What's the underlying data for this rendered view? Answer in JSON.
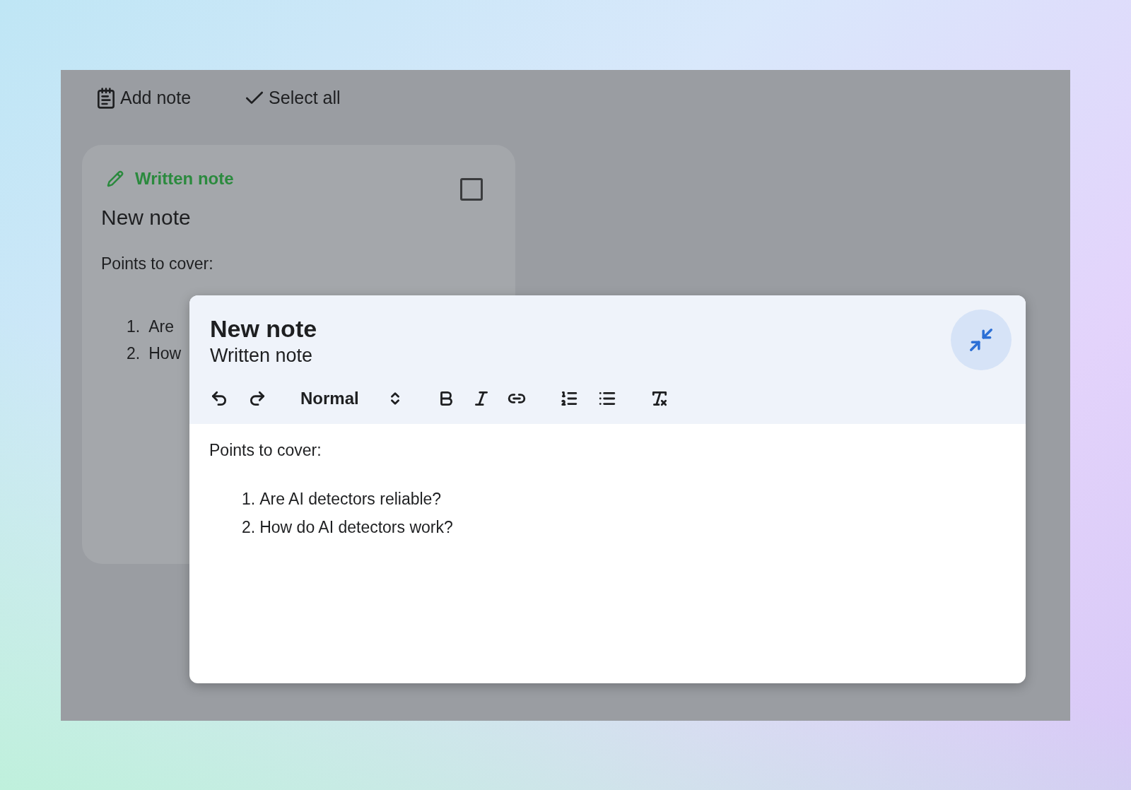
{
  "toolbar": [
    {
      "kind": "add",
      "label": "Add note"
    },
    {
      "kind": "select",
      "label": "Select all"
    }
  ],
  "note_card": {
    "type_label": "Written note",
    "title": "New note",
    "checked": false,
    "body": "Points to cover:",
    "list": [
      {
        "number": "1.",
        "text": "Are"
      },
      {
        "number": "2.",
        "text": "How"
      }
    ]
  },
  "editor": {
    "title": "New note",
    "subtitle": "Written note",
    "format_tools": [
      {
        "kind": "undo"
      },
      {
        "kind": "redo"
      },
      {
        "kind": "style",
        "label": "Normal"
      },
      {
        "kind": "bold"
      },
      {
        "kind": "italic"
      },
      {
        "kind": "link"
      },
      {
        "kind": "ordered"
      },
      {
        "kind": "bullets"
      },
      {
        "kind": "clear"
      }
    ],
    "body": "Points to cover:",
    "list": [
      {
        "number": "1.",
        "text": "Are AI detectors reliable?"
      },
      {
        "number": "2.",
        "text": "How do AI detectors work?"
      }
    ]
  }
}
